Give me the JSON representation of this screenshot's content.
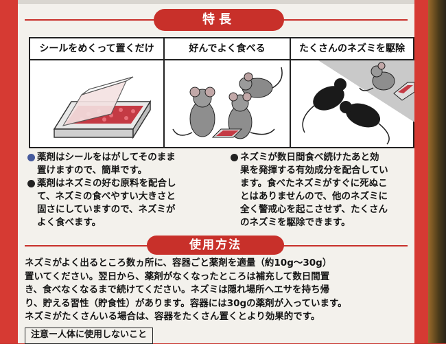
{
  "sections": {
    "features_title": "特長",
    "usage_title": "使用方法"
  },
  "panels": [
    {
      "title": "シールをめくって置くだけ",
      "icon": "bait-tray-peel-icon"
    },
    {
      "title": "好んでよく食べる",
      "icon": "mice-eating-icon"
    },
    {
      "title": "たくさんのネズミを駆除",
      "icon": "mice-eliminated-icon"
    }
  ],
  "bullets_left": [
    {
      "color": "#465a9c",
      "text": "薬剤はシールをはがしてそのまま\n置けますので、簡単です。"
    },
    {
      "color": "#222222",
      "text": "薬剤はネズミの好む原料を配合し\nて、ネズミの食べやすい大きさと\n固さにしていますので、ネズミが\nよく食べます。"
    }
  ],
  "bullets_right": [
    {
      "color": "#222222",
      "text": "ネズミが数日間食べ続けたあと効\n果を発揮する有効成分を配合してい\nます。食べたネズミがすぐに死ぬこ\nとはありませんので、他のネズミに\n全く警戒心を起こさせず、たくさん\nのネズミを駆除できます。"
    }
  ],
  "usage_text": "ネズミがよく出るところ数ヵ所に、容器ごと薬剤を適量（約10g～30g）\n置いてください。翌日から、薬剤がなくなったところは補充して数日間置\nき、食べなくなるまで続けてください。ネズミは隠れ場所へエサを持ち帰\nり、貯える習性（貯食性）があります。容器には30gの薬剤が入っています。\nネズミがたくさんいる場合は、容器をたくさん置くとより効果的です。",
  "caution": "注意ー人体に使用しないこと",
  "colors": {
    "accent_red": "#c8302a",
    "paper": "#f3f1ec"
  }
}
